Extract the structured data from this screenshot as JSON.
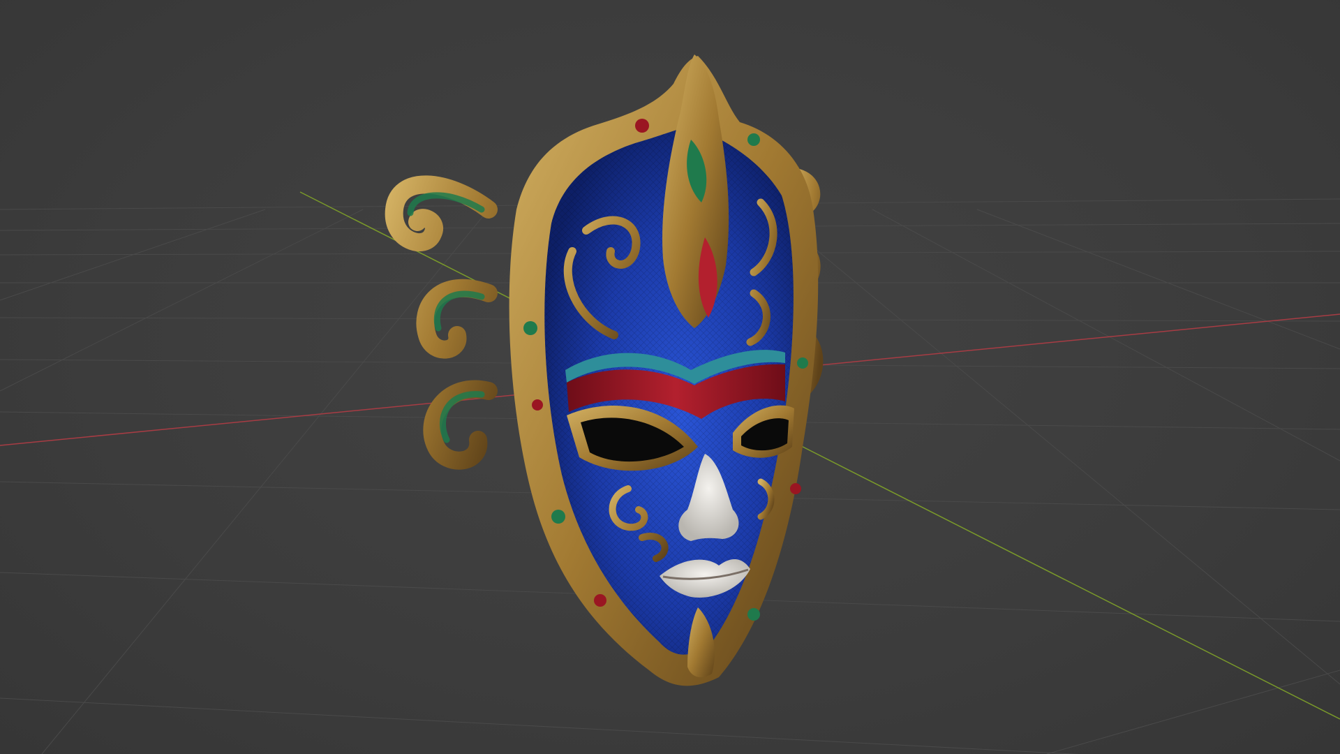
{
  "app": {
    "name": "3D viewport"
  },
  "viewport": {
    "background_color": "#3d3d3d",
    "grid_color": "#4a4a4a",
    "x_axis_color": "#a83c44",
    "y_axis_color": "#7a9a2a",
    "grid_visible": true,
    "axes_visible": true
  },
  "scene_object": {
    "icon": "venetian-mask-model",
    "colors": {
      "face": "#1e40b8",
      "face_dark": "#0d1f66",
      "gold": "#b48a3a",
      "gold_dark": "#6b4e1f",
      "red": "#9a1622",
      "green": "#1f7a4c",
      "teal": "#2e8e9a",
      "white": "#e8e6e2"
    }
  }
}
